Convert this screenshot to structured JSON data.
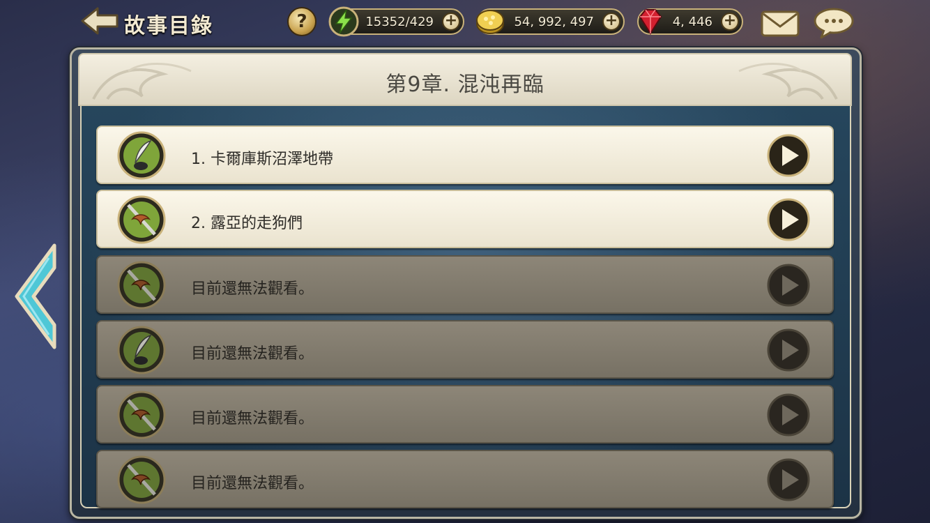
{
  "header": {
    "title": "故事目錄",
    "help_label": "?"
  },
  "resources": {
    "energy": {
      "value": "15352/429",
      "icon": "lightning-icon",
      "color": "#7bd33a"
    },
    "gold": {
      "value": "54, 992, 497",
      "icon": "gold-coin-icon",
      "color": "#e3c04a"
    },
    "gems": {
      "value": "4, 446",
      "icon": "ruby-gem-icon",
      "color": "#d21f2f"
    },
    "plus_label": "+"
  },
  "chapter": {
    "title": "第9章.  混沌再臨"
  },
  "stories": [
    {
      "label": "1.  卡爾庫斯沼澤地帶",
      "unlocked": true,
      "icon": "quill-inkpot-icon"
    },
    {
      "label": "2.  露亞的走狗們",
      "unlocked": true,
      "icon": "sword-wings-icon"
    },
    {
      "label": "目前還無法觀看。",
      "unlocked": false,
      "icon": "sword-wings-icon"
    },
    {
      "label": "目前還無法觀看。",
      "unlocked": false,
      "icon": "quill-inkpot-icon"
    },
    {
      "label": "目前還無法觀看。",
      "unlocked": false,
      "icon": "sword-wings-icon"
    },
    {
      "label": "目前還無法觀看。",
      "unlocked": false,
      "icon": "sword-wings-icon"
    }
  ],
  "colors": {
    "accent_gold": "#c9b27a",
    "row_unlocked": "#f7f2e2",
    "row_locked": "#837d70",
    "arrow_cyan": "#4fc7d6"
  }
}
